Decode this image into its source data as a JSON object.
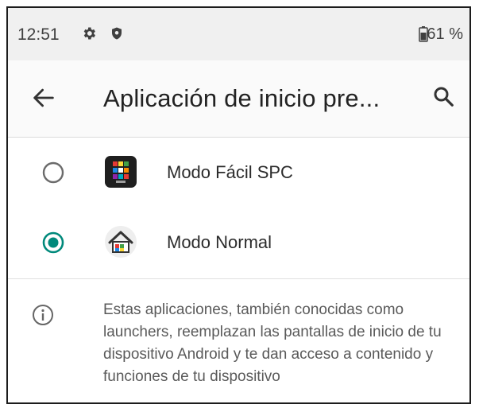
{
  "status_bar": {
    "time": "12:51",
    "battery": "61 %",
    "icons": [
      "gear-icon",
      "shield-icon",
      "battery-icon"
    ]
  },
  "toolbar": {
    "title": "Aplicación de inicio pre...",
    "back_icon": "arrow-left-icon",
    "search_icon": "search-icon"
  },
  "apps": [
    {
      "label": "Modo Fácil SPC",
      "selected": false,
      "icon": "spc-easy-mode-icon"
    },
    {
      "label": "Modo Normal",
      "selected": true,
      "icon": "home-launcher-icon"
    }
  ],
  "info": {
    "icon": "info-icon",
    "text": "Estas aplicaciones, también conocidas como launchers, reemplazan las pantallas de inicio de tu dispositivo Android y te dan acceso a contenido y funciones de tu dispositivo"
  },
  "colors": {
    "accent": "#00897b",
    "status_bar_bg": "#f0f0f0",
    "toolbar_bg": "#fafafa"
  }
}
